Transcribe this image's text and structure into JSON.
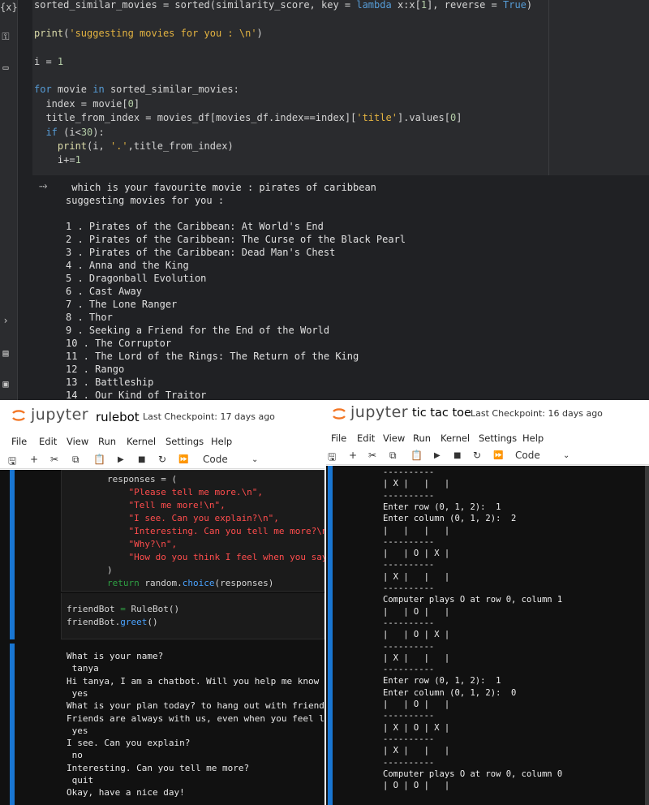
{
  "colab": {
    "code_lines": [
      [
        [
          "op",
          "sorted_similar_movies = sorted(similarity_score, key = "
        ],
        [
          "kw",
          "lambda"
        ],
        [
          "op",
          " x:x["
        ],
        [
          "nm",
          "1"
        ],
        [
          "op",
          "], reverse = "
        ],
        [
          "tr",
          "True"
        ],
        [
          "op",
          ")"
        ]
      ],
      [],
      [
        [
          "fn",
          "print"
        ],
        [
          "op",
          "("
        ],
        [
          "st",
          "'suggesting movies for you : \\n'"
        ],
        [
          "op",
          ")"
        ]
      ],
      [],
      [
        [
          "op",
          "i = "
        ],
        [
          "nm",
          "1"
        ]
      ],
      [],
      [
        [
          "kw",
          "for"
        ],
        [
          "op",
          " movie "
        ],
        [
          "kw",
          "in"
        ],
        [
          "op",
          " sorted_similar_movies:"
        ]
      ],
      [
        [
          "op",
          "  index = movie["
        ],
        [
          "nm",
          "0"
        ],
        [
          "op",
          "]"
        ]
      ],
      [
        [
          "op",
          "  title_from_index = movies_df[movies_df.index==index]["
        ],
        [
          "st",
          "'title'"
        ],
        [
          "op",
          "].values["
        ],
        [
          "nm",
          "0"
        ],
        [
          "op",
          "]"
        ]
      ],
      [
        [
          "op",
          "  "
        ],
        [
          "kw",
          "if"
        ],
        [
          "op",
          " (i<"
        ],
        [
          "nm",
          "30"
        ],
        [
          "op",
          "):"
        ]
      ],
      [
        [
          "op",
          "    "
        ],
        [
          "fn",
          "print"
        ],
        [
          "op",
          "(i, "
        ],
        [
          "st",
          "'.'"
        ],
        [
          "op",
          ",title_from_index)"
        ]
      ],
      [
        [
          "op",
          "    i+="
        ],
        [
          "nm",
          "1"
        ]
      ]
    ],
    "output_lines": [
      " which is your favourite movie : pirates of caribbean",
      "suggesting movies for you :",
      "",
      "1 . Pirates of the Caribbean: At World's End",
      "2 . Pirates of the Caribbean: The Curse of the Black Pearl",
      "3 . Pirates of the Caribbean: Dead Man's Chest",
      "4 . Anna and the King",
      "5 . Dragonball Evolution",
      "6 . Cast Away",
      "7 . The Lone Ranger",
      "8 . Thor",
      "9 . Seeking a Friend for the End of the World",
      "10 . The Corruptor",
      "11 . The Lord of the Rings: The Return of the King",
      "12 . Rango",
      "13 . Battleship",
      "14 . Our Kind of Traitor"
    ]
  },
  "left_nb": {
    "brand": "jupyter",
    "title": "rulebot",
    "checkpoint": "Last Checkpoint: 17 days ago",
    "menu": [
      "File",
      "Edit",
      "View",
      "Run",
      "Kernel",
      "Settings",
      "Help"
    ],
    "kernel_select": "Code",
    "code_lines": [
      [
        [
          "op",
          "responses = ("
        ]
      ],
      [
        [
          "s2",
          "    \"Please tell me more.\\n\","
        ]
      ],
      [
        [
          "s2",
          "    \"Tell me more!\\n\","
        ]
      ],
      [
        [
          "s2",
          "    \"I see. Can you explain?\\n\","
        ]
      ],
      [
        [
          "s2",
          "    \"Interesting. Can you tell me more?\\n\","
        ]
      ],
      [
        [
          "s2",
          "    \"Why?\\n\","
        ]
      ],
      [
        [
          "s2",
          "    \"How do you think I feel when you say t"
        ]
      ],
      [
        [
          "op",
          ")"
        ]
      ],
      [
        [
          "k2",
          "return"
        ],
        [
          "op",
          " random."
        ],
        [
          "f2",
          "choice"
        ],
        [
          "op",
          "(responses)"
        ]
      ]
    ],
    "code2_lines": [
      [
        [
          "op",
          "friendBot "
        ],
        [
          "k2",
          "="
        ],
        [
          "op",
          " RuleBot()"
        ]
      ],
      [
        [
          "op",
          "friendBot."
        ],
        [
          "f2",
          "greet"
        ],
        [
          "op",
          "()"
        ]
      ]
    ],
    "output_lines": [
      "What is your name?",
      " tanya",
      "Hi tanya, I am a chatbot. Will you help me know abo",
      " yes",
      "What is your plan today? to hang out with friends",
      "Friends are always with us, even when you feel low.",
      " yes",
      "I see. Can you explain?",
      " no",
      "Interesting. Can you tell me more?",
      " quit",
      "Okay, have a nice day!"
    ]
  },
  "right_nb": {
    "brand": "jupyter",
    "title": "tic tac toe",
    "checkpoint": "Last Checkpoint: 16 days ago",
    "menu": [
      "File",
      "Edit",
      "View",
      "Run",
      "Kernel",
      "Settings",
      "Help"
    ],
    "kernel_select": "Code",
    "output_lines": [
      "----------",
      "| X |   |   |",
      "----------",
      "Enter row (0, 1, 2):  1",
      "Enter column (0, 1, 2):  2",
      "|   |   |   |",
      "----------",
      "|   | O | X |",
      "----------",
      "| X |   |   |",
      "----------",
      "Computer plays O at row 0, column 1",
      "|   | O |   |",
      "----------",
      "|   | O | X |",
      "----------",
      "| X |   |   |",
      "----------",
      "Enter row (0, 1, 2):  1",
      "Enter column (0, 1, 2):  0",
      "|   | O |   |",
      "----------",
      "| X | O | X |",
      "----------",
      "| X |   |   |",
      "----------",
      "Computer plays O at row 0, column 0",
      "| O | O |   |"
    ]
  }
}
